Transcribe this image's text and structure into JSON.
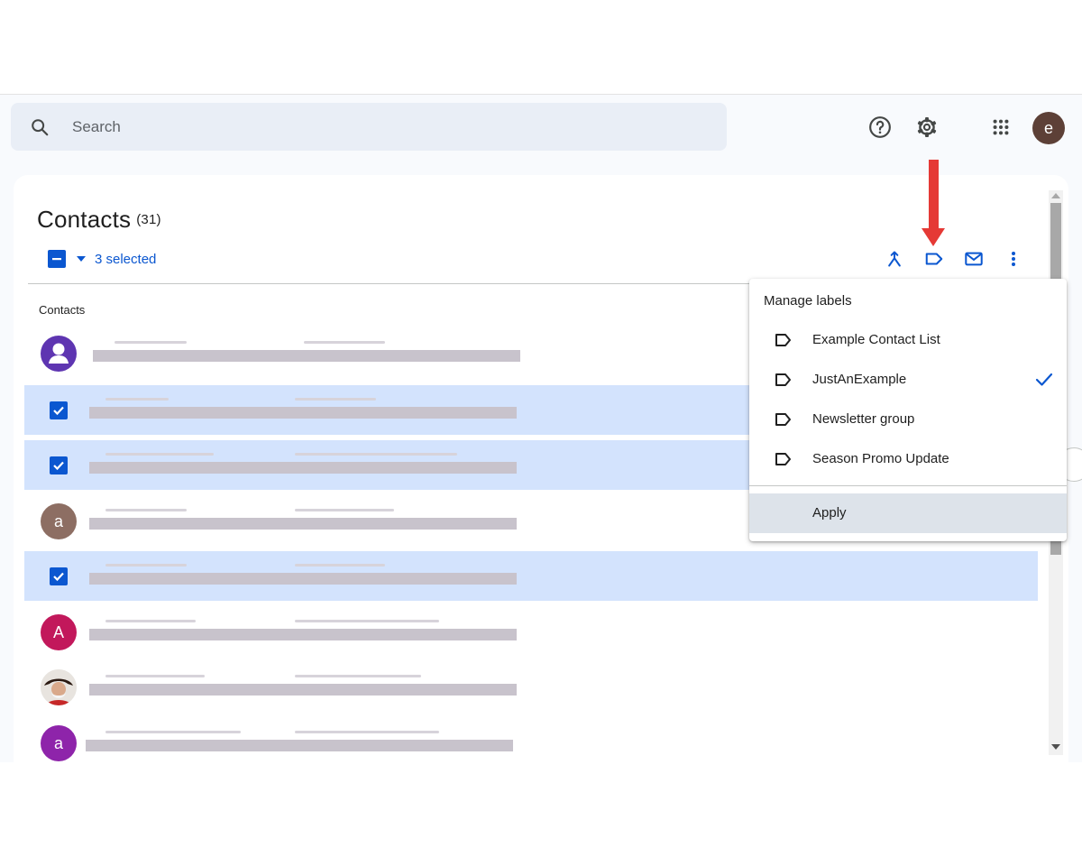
{
  "search": {
    "placeholder": "Search"
  },
  "topbar": {
    "help_icon": "help-circle-icon",
    "settings_icon": "gear-icon",
    "apps_icon": "apps-grid-icon",
    "account_initial": "e"
  },
  "header": {
    "title": "Contacts",
    "count": "(31)",
    "selected_text": "3 selected"
  },
  "toolbar": {
    "icons": [
      "merge-icon",
      "label-icon",
      "email-icon",
      "more-vert-icon"
    ]
  },
  "list": {
    "section_label": "Contacts",
    "rows": [
      {
        "avatar": "person-icon",
        "selected": false
      },
      {
        "avatar": "checkbox",
        "selected": true
      },
      {
        "avatar": "checkbox",
        "selected": true
      },
      {
        "avatar": "a",
        "selected": false
      },
      {
        "avatar": "checkbox",
        "selected": true
      },
      {
        "avatar": "A",
        "selected": false
      },
      {
        "avatar": "photo",
        "selected": false
      },
      {
        "avatar": "a",
        "selected": false
      }
    ]
  },
  "menu": {
    "header": "Manage labels",
    "items": [
      {
        "label": "Example Contact List",
        "checked": false
      },
      {
        "label": "JustAnExample",
        "checked": true
      },
      {
        "label": "Newsletter group",
        "checked": false
      },
      {
        "label": "Season Promo Update",
        "checked": false
      }
    ],
    "apply_label": "Apply"
  },
  "colors": {
    "accent": "#0b57d0",
    "selected_row": "#d3e3fd",
    "annotation_arrow": "#e53935",
    "avatar_purple": "#5e35b1",
    "avatar_brown": "#8d6e63",
    "avatar_pink": "#c2185b",
    "avatar_violet": "#8e24aa"
  }
}
